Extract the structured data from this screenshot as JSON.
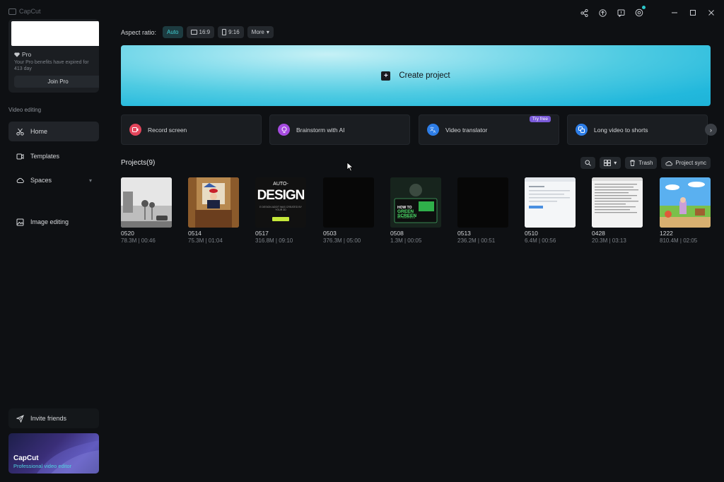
{
  "app": {
    "name": "CapCut"
  },
  "sidebar": {
    "pro": {
      "title": "Pro",
      "description": "Your Pro benefits have expired for 413 day",
      "join_label": "Join Pro"
    },
    "section_label": "Video editing",
    "items": [
      {
        "label": "Home",
        "icon": "scissors-icon",
        "active": true
      },
      {
        "label": "Templates",
        "icon": "templates-icon"
      },
      {
        "label": "Spaces",
        "icon": "cloud-icon"
      },
      {
        "label": "Image editing",
        "icon": "image-icon"
      }
    ],
    "invite_label": "Invite friends",
    "promo": {
      "title": "CapCut",
      "subtitle": "Professional video editor"
    }
  },
  "aspect": {
    "label": "Aspect ratio:",
    "options": [
      "Auto",
      "16:9",
      "9:16"
    ],
    "more_label": "More"
  },
  "create": {
    "label": "Create project"
  },
  "tools": [
    {
      "label": "Record screen",
      "icon": "record-icon",
      "color": "#e2455b"
    },
    {
      "label": "Brainstorm with AI",
      "icon": "bulb-icon",
      "color": "#a64be0"
    },
    {
      "label": "Video translator",
      "icon": "translate-icon",
      "color": "#2d7de6",
      "badge": "Try free"
    },
    {
      "label": "Long video to shorts",
      "icon": "shorts-icon",
      "color": "#2d7de6"
    }
  ],
  "projects": {
    "title": "Projects(9)",
    "trash_label": "Trash",
    "sync_label": "Project sync",
    "items": [
      {
        "name": "0520",
        "meta": "78.3M | 00:46"
      },
      {
        "name": "0514",
        "meta": "75.3M | 01:04"
      },
      {
        "name": "0517",
        "meta": "316.8M | 09:10",
        "thumb_text": "AUTO-DESIGN",
        "thumb_sub": "E DESIGN ADDIT WAS CREATED BY YOUR 3D"
      },
      {
        "name": "0503",
        "meta": "376.3M | 05:00"
      },
      {
        "name": "0508",
        "meta": "1.3M | 00:05",
        "thumb_text": "HOW TO GREEN SCREEN",
        "thumb_sub": "IN FILMORA 14"
      },
      {
        "name": "0513",
        "meta": "236.2M | 00:51"
      },
      {
        "name": "0510",
        "meta": "6.4M | 00:56"
      },
      {
        "name": "0428",
        "meta": "20.3M | 03:13"
      },
      {
        "name": "1222",
        "meta": "810.4M | 02:05"
      }
    ]
  }
}
